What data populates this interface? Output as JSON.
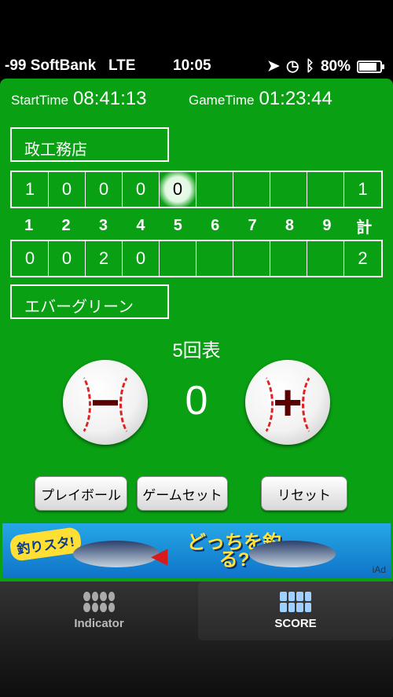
{
  "status": {
    "carrier": "-99 SoftBank",
    "network": "LTE",
    "time": "10:05",
    "battery": "80%"
  },
  "timers": {
    "start_label": "StartTime",
    "start_value": "08:41:13",
    "game_label": "GameTime",
    "game_value": "01:23:44"
  },
  "team_top": {
    "name": "政工務店"
  },
  "team_bottom": {
    "name": "エバーグリーン"
  },
  "scoreboard": {
    "top_scores": [
      "1",
      "0",
      "0",
      "0",
      "0",
      "",
      "",
      "",
      "",
      "1"
    ],
    "innings": [
      "1",
      "2",
      "3",
      "4",
      "5",
      "6",
      "7",
      "8",
      "9",
      "計"
    ],
    "bottom_scores": [
      "0",
      "0",
      "2",
      "0",
      "",
      "",
      "",
      "",
      "",
      "2"
    ],
    "active_inning_index": 4
  },
  "inning_label": "5回表",
  "counter": {
    "minus": "−",
    "value": "0",
    "plus": "+"
  },
  "buttons": {
    "play_ball": "プレイボール",
    "game_set": "ゲームセット",
    "reset": "リセット"
  },
  "ad": {
    "brand": "釣りスタ!",
    "headline": "どっちを釣る?",
    "badge": "iAd"
  },
  "tabs": [
    {
      "label": "Indicator",
      "icon": "bso-indicator-icon",
      "active": false
    },
    {
      "label": "SCORE",
      "icon": "scoreboard-icon",
      "active": true
    }
  ],
  "colors": {
    "field_green": "#0aa014",
    "seam_red": "#d22"
  }
}
